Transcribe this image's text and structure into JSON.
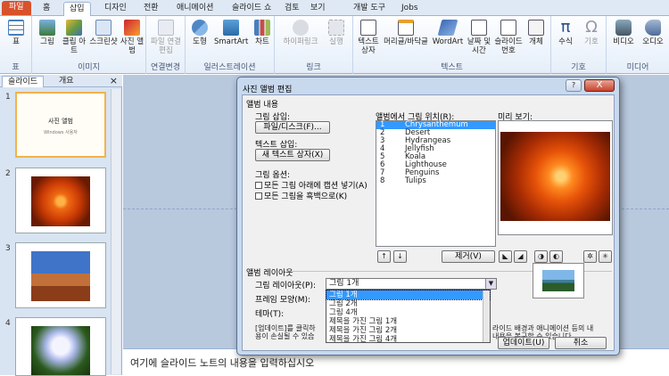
{
  "tabs": [
    "파일",
    "홈",
    "삽입",
    "디자인",
    "전환",
    "애니메이션",
    "슬라이드 쇼",
    "검토",
    "보기",
    "개발 도구",
    "Jobs"
  ],
  "ribbon": {
    "groups": [
      {
        "label": "표",
        "buttons": [
          "표"
        ]
      },
      {
        "label": "이미지",
        "buttons": [
          "그림",
          "클립 아트",
          "스크린샷",
          "사진 앨범"
        ]
      },
      {
        "label": "연결변경",
        "buttons": [
          "파일 연결 편집"
        ]
      },
      {
        "label": "일러스트레이션",
        "buttons": [
          "도형",
          "SmartArt",
          "차트"
        ]
      },
      {
        "label": "링크",
        "buttons": [
          "하이퍼링크",
          "실행"
        ]
      },
      {
        "label": "텍스트",
        "buttons": [
          "텍스트 상자",
          "머리글/바닥글",
          "WordArt",
          "날짜 및 시간",
          "슬라이드 번호",
          "개체"
        ]
      },
      {
        "label": "기호",
        "buttons": [
          "수식",
          "기호"
        ]
      },
      {
        "label": "미디어",
        "buttons": [
          "비디오",
          "오디오"
        ]
      }
    ]
  },
  "pane": {
    "tabs": [
      "슬라이드",
      "개요"
    ],
    "close": "×",
    "slides": [
      {
        "num": "1",
        "title": "사진 앨범",
        "subtitle": "Windows 사용자"
      },
      {
        "num": "2"
      },
      {
        "num": "3"
      },
      {
        "num": "4"
      }
    ]
  },
  "notes_placeholder": "여기에 슬라이드 노트의 내용을 입력하십시오",
  "dialog": {
    "title": "사진 앨범 편집",
    "help": "?",
    "close": "X",
    "album_content": "앨범 내용",
    "insert_picture": "그림 삽입:",
    "file_disk_button": "파일/디스크(F)...",
    "insert_text": "텍스트 삽입:",
    "new_textbox_button": "새 텍스트 상자(X)",
    "picture_options": "그림 옵션:",
    "caption_option": "모든 그림 아래에 캡션 넣기(A)",
    "bw_option": "모든 그림을 흑백으로(K)",
    "pictures_in_album": "앨범에서 그림 위치(R):",
    "pictures": [
      {
        "n": "1",
        "name": "Chrysanthemum"
      },
      {
        "n": "2",
        "name": "Desert"
      },
      {
        "n": "3",
        "name": "Hydrangeas"
      },
      {
        "n": "4",
        "name": "Jellyfish"
      },
      {
        "n": "5",
        "name": "Koala"
      },
      {
        "n": "6",
        "name": "Lighthouse"
      },
      {
        "n": "7",
        "name": "Penguins"
      },
      {
        "n": "8",
        "name": "Tulips"
      }
    ],
    "preview_label": "미리 보기:",
    "remove_button": "제거(V)",
    "move_up": "↑",
    "move_down": "↓",
    "album_layout": "앨범 레이아웃",
    "picture_layout_label": "그림 레이아웃(P):",
    "picture_layout_value": "그림 1개",
    "frame_shape_label": "프레임 모양(M):",
    "theme_label": "테마(T):",
    "layout_options": [
      "그림 1개",
      "그림 2개",
      "그림 4개",
      "제목을 가진 그림 1개",
      "제목을 가진 그림 2개",
      "제목을 가진 그림 4개"
    ],
    "note_text_left": "[업데이트]를 클릭하\n용이 손실될 수 있습",
    "note_text_right": "라이드 배경과 애니메이션 등의 내\n내용을 복구할 수 있습니다.",
    "update_button": "업데이트(U)",
    "cancel_button": "취소"
  },
  "colors": {
    "accent": "#d8522b",
    "selection": "#3399ff",
    "ribbon_border": "#9db4d3"
  }
}
